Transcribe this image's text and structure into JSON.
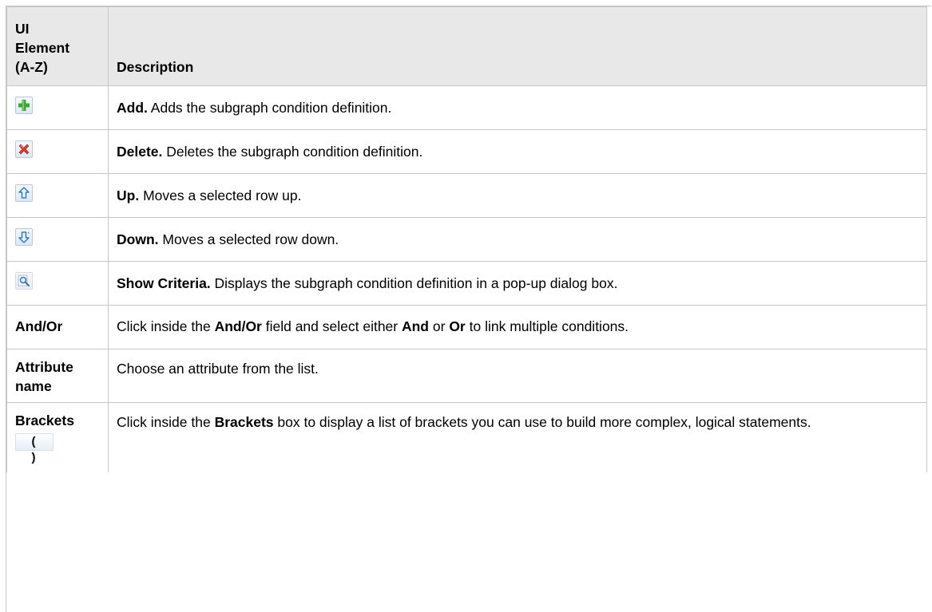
{
  "header": {
    "element_col": "UI Element (A-Z)",
    "element_col_lines": [
      "UI",
      "Element",
      "(A-Z)"
    ],
    "description_col": "Description"
  },
  "rows": [
    {
      "icon": "add-icon",
      "name": "Add.",
      "text": " Adds the subgraph condition definition."
    },
    {
      "icon": "delete-icon",
      "name": "Delete.",
      "text": " Deletes the subgraph condition definition."
    },
    {
      "icon": "up-arrow-icon",
      "name": "Up.",
      "text": " Moves a selected row up."
    },
    {
      "icon": "down-arrow-icon",
      "name": "Down.",
      "text": " Moves a selected row down."
    },
    {
      "icon": "magnifier-icon",
      "name": "Show Criteria.",
      "text": " Displays the subgraph condition definition in a pop-up dialog box."
    }
  ],
  "andor": {
    "element": "And/Or",
    "t1": "Click inside the ",
    "b1": "And/Or",
    "t2": " field and select either ",
    "b2": "And",
    "t3": " or ",
    "b3": "Or",
    "t4": " to link multiple conditions."
  },
  "attribute": {
    "element_line1": "Attribute",
    "element_line2": "name",
    "text": "Choose an attribute from the list."
  },
  "brackets": {
    "element": "Brackets",
    "icon_text": "( )",
    "t1": "Click inside the ",
    "b1": "Brackets",
    "t2": " box to display a list of brackets you can use to build more complex, logical statements."
  },
  "colors": {
    "header_bg": "#e8e8e8",
    "border": "#c6c6c6",
    "add_green": "#3aa832",
    "delete_red": "#d93a2b",
    "arrow_blue": "#2f7fd0"
  }
}
